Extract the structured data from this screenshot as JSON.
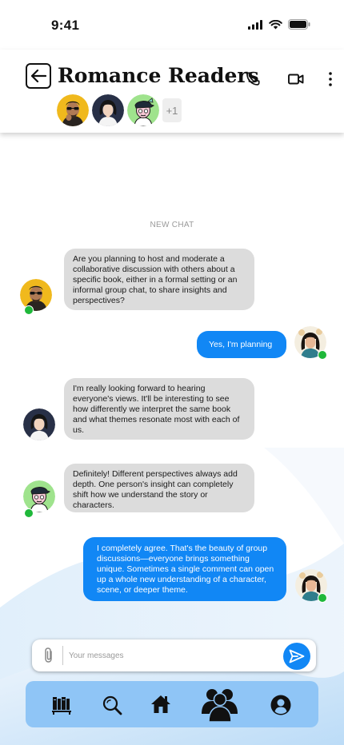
{
  "status_bar": {
    "time": "9:41"
  },
  "header": {
    "title": "Romance Readers",
    "members_extra": "+1",
    "members": [
      {
        "name": "member-1",
        "avatar": "man-sunglasses-avatar"
      },
      {
        "name": "member-2",
        "avatar": "woman-avatar"
      },
      {
        "name": "member-3",
        "avatar": "cartoon-avatar"
      }
    ]
  },
  "chat": {
    "divider": "NEW CHAT",
    "messages": [
      {
        "from": "member-1",
        "direction": "incoming",
        "text": "Are you planning to host and moderate a collaborative discussion with others about a specific book, either in a formal setting or an informal group chat, to share insights and perspectives?"
      },
      {
        "from": "me",
        "direction": "outgoing",
        "text": "Yes, I'm planning"
      },
      {
        "from": "member-2",
        "direction": "incoming",
        "text": "I'm really looking forward to hearing everyone's views. It'll be interesting to see how differently we interpret the same book and what themes resonate most with each of us."
      },
      {
        "from": "member-3",
        "direction": "incoming",
        "text": "Definitely! Different perspectives always add depth. One person's insight can completely shift how we understand the story or characters."
      },
      {
        "from": "me",
        "direction": "outgoing",
        "text": "I completely agree. That's the beauty of group discussions—everyone brings something unique. Sometimes a single comment can open up a whole new understanding of a character, scene, or deeper theme."
      }
    ]
  },
  "composer": {
    "placeholder": "Your messages",
    "value": ""
  },
  "nav": {
    "items": [
      {
        "name": "library",
        "icon": "bookshelf-icon"
      },
      {
        "name": "search",
        "icon": "search-icon"
      },
      {
        "name": "home",
        "icon": "home-icon"
      },
      {
        "name": "groups",
        "icon": "group-icon",
        "active": true
      },
      {
        "name": "profile",
        "icon": "profile-icon"
      }
    ]
  },
  "colors": {
    "accent": "#1187f5",
    "incoming_bubble": "#dcdcdc",
    "online": "#1fb83a",
    "nav_background": "#8fc5f6"
  }
}
